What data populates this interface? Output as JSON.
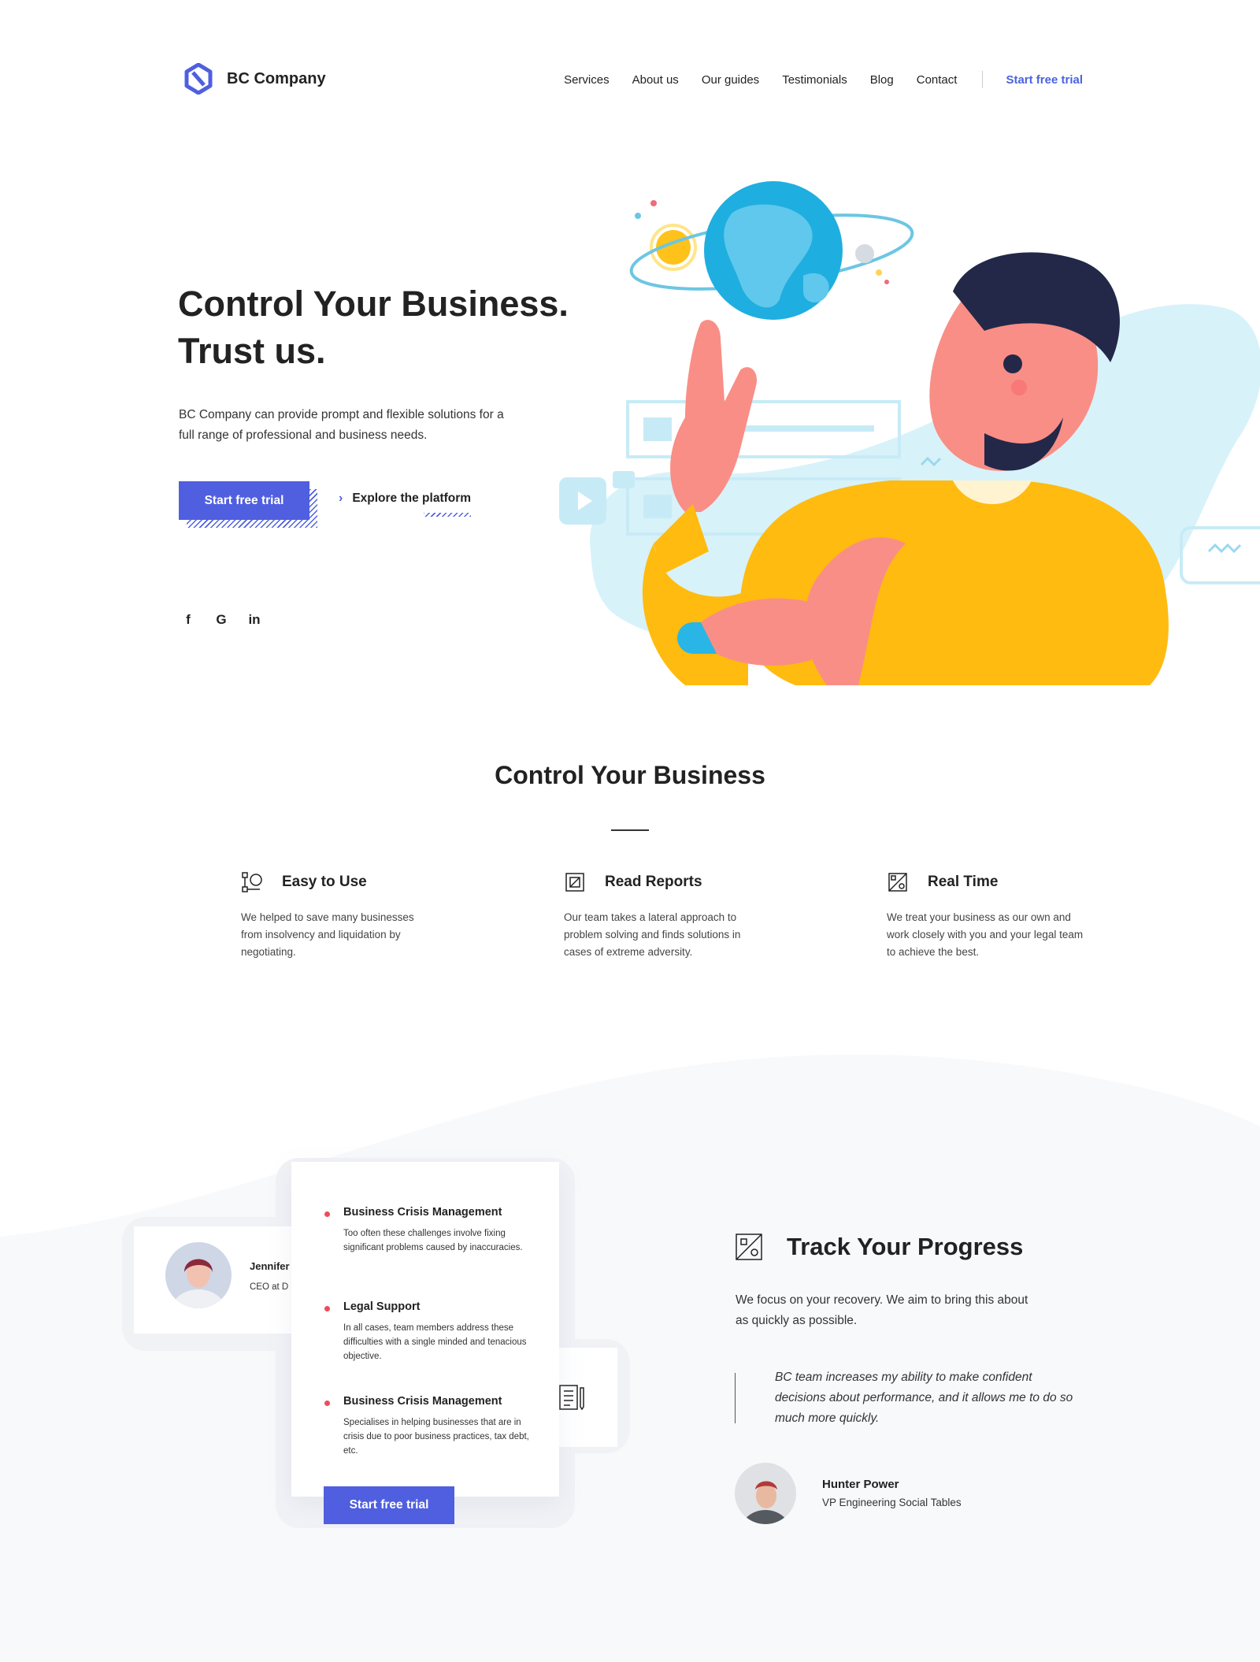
{
  "brand": {
    "name": "BC Company",
    "accent": "#4f5fe0",
    "logo_icon": "hexagon-logo-icon"
  },
  "nav": {
    "items": [
      "Services",
      "About us",
      "Our guides",
      "Testimonials",
      "Blog",
      "Contact"
    ],
    "cta": "Start free trial"
  },
  "hero": {
    "title_line1": "Control Your Business.",
    "title_line2": "Trust us.",
    "description": "BC Company can provide prompt and flexible solutions for a full range of professional and business needs.",
    "primary_button": "Start free trial",
    "secondary_link": "Explore the platform",
    "social": [
      {
        "icon": "facebook-icon",
        "glyph": "f"
      },
      {
        "icon": "google-icon",
        "glyph": "G"
      },
      {
        "icon": "linkedin-icon",
        "glyph": "in"
      }
    ]
  },
  "features": {
    "title": "Control Your Business",
    "items": [
      {
        "icon": "workflow-icon",
        "title": "Easy to Use",
        "description": "We helped to save many businesses from insolvency and liquidation by negotiating."
      },
      {
        "icon": "report-icon",
        "title": "Read Reports",
        "description": "Our team takes a lateral approach to problem solving and finds solutions in cases of extreme adversity."
      },
      {
        "icon": "realtime-icon",
        "title": "Real Time",
        "description": "We treat your business as our own and work closely with you and your legal team to achieve the best."
      }
    ]
  },
  "showcase": {
    "person": {
      "name": "Jennifer",
      "role": "CEO at D"
    },
    "list": [
      {
        "title": "Business Crisis Management",
        "description": "Too often these challenges involve fixing significant problems caused by inaccuracies."
      },
      {
        "title": "Legal Support",
        "description": "In all cases, team members address these difficulties with a single minded and tenacious objective."
      },
      {
        "title": "Business Crisis Management",
        "description": "Specialises in helping businesses that are in crisis due to poor business practices, tax debt, etc."
      }
    ],
    "button": "Start free trial"
  },
  "track": {
    "title": "Track Your Progress",
    "description": "We focus on your recovery. We aim to bring this about as quickly as possible.",
    "quote": "BC team increases my ability to make confident decisions about performance, and it allows me to do so much more quickly.",
    "author_name": "Hunter Power",
    "author_role": "VP Engineering Social Tables"
  }
}
